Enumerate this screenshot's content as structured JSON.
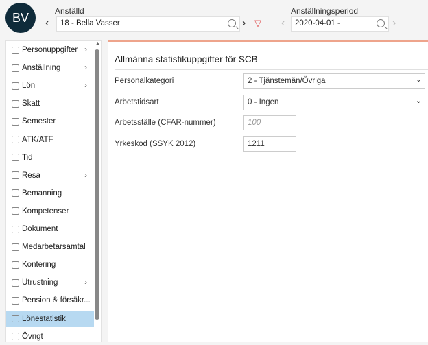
{
  "header": {
    "avatar_initials": "BV",
    "employee_label": "Anställd",
    "employee_value": "18 - Bella Vasser",
    "period_label": "Anställningsperiod",
    "period_value": "2020-04-01 -"
  },
  "sidebar": {
    "items": [
      {
        "label": "Personuppgifter",
        "icon": "id-card-icon",
        "chevron": true
      },
      {
        "label": "Anställning",
        "icon": "person-icon",
        "chevron": true
      },
      {
        "label": "Lön",
        "icon": "money-icon",
        "chevron": true
      },
      {
        "label": "Skatt",
        "icon": "building-icon",
        "chevron": false
      },
      {
        "label": "Semester",
        "icon": "palm-icon",
        "chevron": false
      },
      {
        "label": "ATK/ATF",
        "icon": "calendar-icon",
        "chevron": false
      },
      {
        "label": "Tid",
        "icon": "clock-icon",
        "chevron": false
      },
      {
        "label": "Resa",
        "icon": "globe-icon",
        "chevron": true
      },
      {
        "label": "Bemanning",
        "icon": "schedule-icon",
        "chevron": false
      },
      {
        "label": "Kompetenser",
        "icon": "graduation-icon",
        "chevron": false
      },
      {
        "label": "Dokument",
        "icon": "document-icon",
        "chevron": false
      },
      {
        "label": "Medarbetarsamtal",
        "icon": "chat-icon",
        "chevron": false
      },
      {
        "label": "Kontering",
        "icon": "tag-icon",
        "chevron": false
      },
      {
        "label": "Utrustning",
        "icon": "folder-icon",
        "chevron": true
      },
      {
        "label": "Pension & försäkr...",
        "icon": "umbrella-icon",
        "chevron": false
      },
      {
        "label": "Lönestatistik",
        "icon": "chart-icon",
        "chevron": false,
        "active": true
      },
      {
        "label": "Övrigt",
        "icon": "document-icon",
        "chevron": false
      }
    ]
  },
  "main": {
    "title": "Allmänna statistikuppgifter för SCB",
    "fields": [
      {
        "label": "Personalkategori",
        "type": "select",
        "value": "2 - Tjänstemän/Övriga"
      },
      {
        "label": "Arbetstidsart",
        "type": "select",
        "value": "0 - Ingen"
      },
      {
        "label": "Arbetsställe (CFAR-nummer)",
        "type": "text",
        "value": "",
        "placeholder": "100"
      },
      {
        "label": "Yrkeskod (SSYK 2012)",
        "type": "text",
        "value": "1211"
      }
    ]
  },
  "colors": {
    "accent": "#eea48c",
    "active": "#b7d9f1",
    "avatar": "#0f2b3a",
    "filter": "#e05050"
  }
}
